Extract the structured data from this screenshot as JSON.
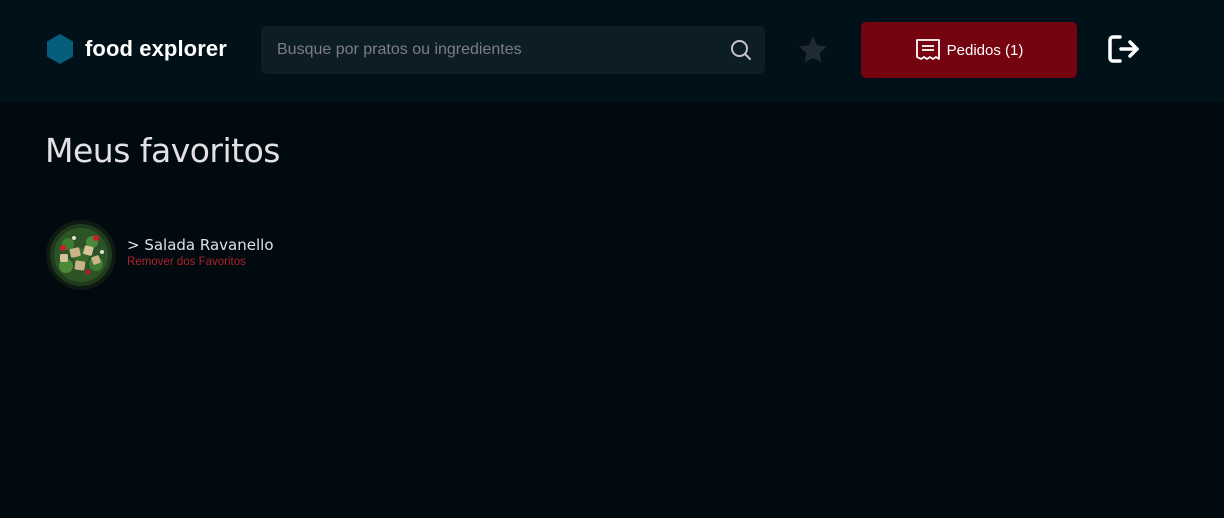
{
  "header": {
    "brand_name": "food explorer",
    "search": {
      "placeholder": "Busque por pratos ou ingredientes",
      "value": ""
    },
    "orders_label": "Pedidos (1)",
    "brand_color": "#065e7c",
    "accent_color": "#750310"
  },
  "main": {
    "title": "Meus favoritos",
    "favorites": [
      {
        "name": "> Salada Ravanello",
        "remove_label": "Remover dos Favoritos"
      }
    ]
  },
  "icons": {
    "brand": "hexagon-logo-icon",
    "search": "search-icon",
    "favorites": "star-icon",
    "orders": "receipt-icon",
    "logout": "sign-out-icon"
  }
}
